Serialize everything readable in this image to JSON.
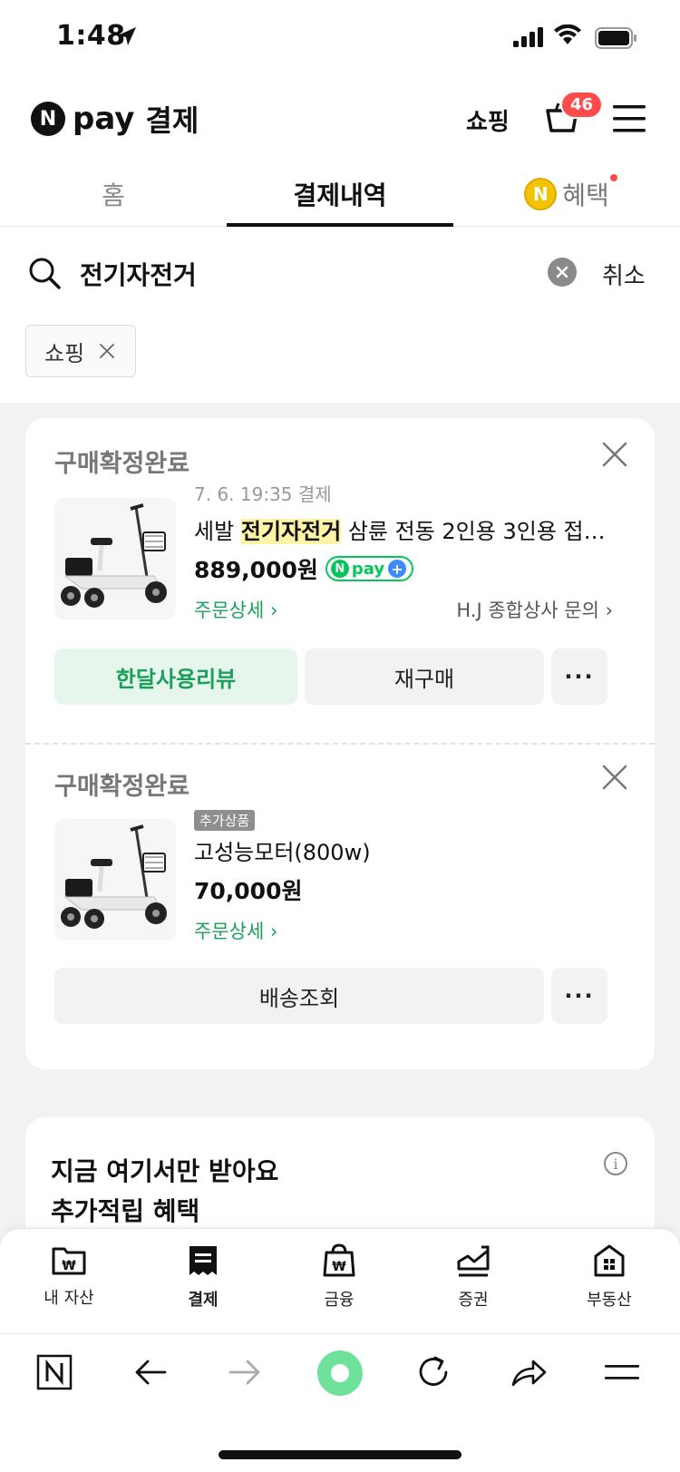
{
  "status_bar": {
    "time": "1:48"
  },
  "header": {
    "logo_n": "N",
    "logo_pay": "pay",
    "logo_title": "결제",
    "shopping_link": "쇼핑",
    "cart_badge": "46"
  },
  "tabs": [
    {
      "label": "홈"
    },
    {
      "label": "결제내역"
    },
    {
      "label": "혜택",
      "coin": "N"
    }
  ],
  "search": {
    "query": "전기자전거",
    "cancel_label": "취소"
  },
  "filter_chip": {
    "label": "쇼핑"
  },
  "orders": [
    {
      "status": "구매확정완료",
      "date": "7. 6. 19:35 결제",
      "title_prefix": "세발 ",
      "title_highlight": "전기자전거",
      "title_suffix": " 삼륜 전동 2인용 3인용 접이...",
      "price": "889,000원",
      "npay_badge": {
        "n": "N",
        "pay": "pay",
        "plus": "+"
      },
      "detail_link": "주문상세 ›",
      "seller_link": "H.J 종합상사 문의 ›",
      "buttons": {
        "review": "한달사용리뷰",
        "rebuy": "재구매",
        "more": "···"
      }
    },
    {
      "status": "구매확정완료",
      "tag": "추가상품",
      "title": "고성능모터(800w)",
      "price": "70,000원",
      "detail_link": "주문상세 ›",
      "buttons": {
        "shipping": "배송조회",
        "more": "···"
      }
    }
  ],
  "promo": {
    "line1": "지금 여기서만 받아요",
    "line2": "추가적립 혜택",
    "info": "i"
  },
  "app_nav": [
    {
      "label": "내 자산",
      "icon": "wallet-folder-icon"
    },
    {
      "label": "결제",
      "icon": "receipt-icon"
    },
    {
      "label": "금융",
      "icon": "money-bag-icon"
    },
    {
      "label": "증권",
      "icon": "chart-up-icon"
    },
    {
      "label": "부동산",
      "icon": "building-icon"
    }
  ],
  "browser_bar": {
    "n_label": "N"
  },
  "colors": {
    "accent_green": "#03c75a",
    "badge_red": "#ff4b4b",
    "highlight": "#fff3a8"
  }
}
